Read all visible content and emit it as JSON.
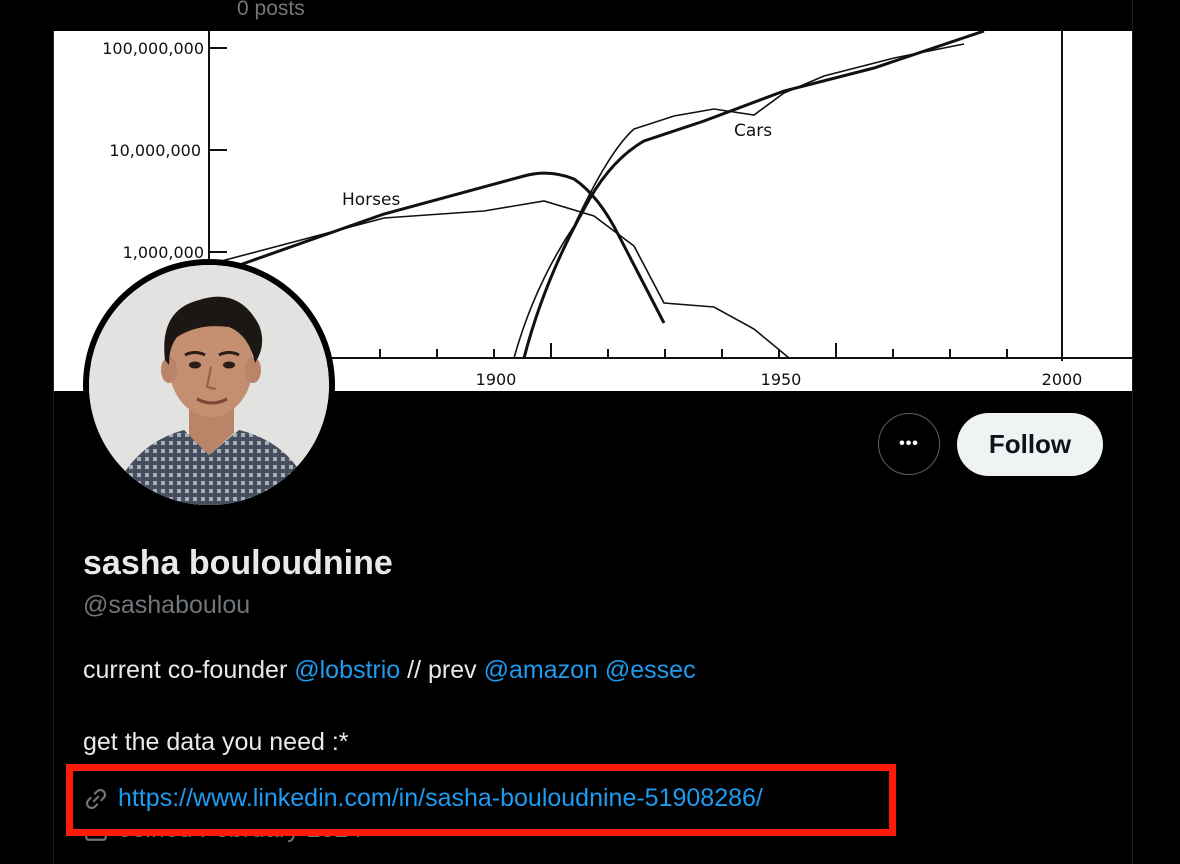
{
  "header": {
    "posts_count": "0 posts"
  },
  "banner": {
    "chart_data": {
      "type": "line",
      "scale_y": "log",
      "y_ticks": [
        "100,000,000",
        "10,000,000",
        "1,000,000"
      ],
      "x_ticks": [
        "1900",
        "1950",
        "2000"
      ],
      "series": [
        {
          "name": "Horses",
          "x": [
            1840,
            1880,
            1900,
            1910,
            1920,
            1930
          ],
          "y": [
            800000,
            2000000,
            4500000,
            5500000,
            2500000,
            400000
          ]
        },
        {
          "name": "Cars",
          "x": [
            1905,
            1910,
            1915,
            1920,
            1930,
            1950,
            1980
          ],
          "y": [
            100000,
            1000000,
            5000000,
            10000000,
            20000000,
            40000000,
            120000000
          ]
        }
      ]
    }
  },
  "profile": {
    "display_name": "sasha bouloudnine",
    "handle": "@sashaboulou",
    "bio_prefix": "current co-founder",
    "mention_1": "@lobstrio",
    "bio_mid": "// prev",
    "mention_2": "@amazon",
    "mention_3": "@essec",
    "bio_line2": "get the data you need :*",
    "link": "https://www.linkedin.com/in/sasha-bouloudnine-51908286/",
    "joined": "Joined February 2024"
  },
  "actions": {
    "more": "•••",
    "follow": "Follow"
  },
  "colors": {
    "accent": "#1d9bf0",
    "highlight": "#ff1a0a",
    "follow_bg": "#eff3f4"
  },
  "icons": {
    "link": "link-icon",
    "calendar": "calendar-icon",
    "more": "more-icon"
  }
}
